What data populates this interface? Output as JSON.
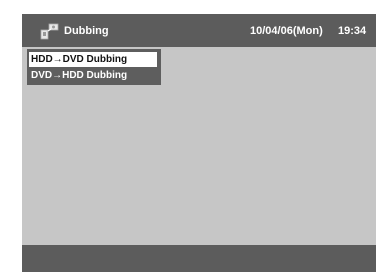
{
  "header": {
    "title": "Dubbing",
    "date": "10/04/06(Mon)",
    "time": "19:34",
    "icon": "dubbing-icon"
  },
  "menu": {
    "items": [
      {
        "label": "HDD→DVD Dubbing",
        "selected": true
      },
      {
        "label": "DVD→HDD Dubbing",
        "selected": false
      }
    ]
  },
  "colors": {
    "background": "#c6c6c6",
    "bar": "#5c5c5c",
    "highlight": "#ffffff"
  }
}
